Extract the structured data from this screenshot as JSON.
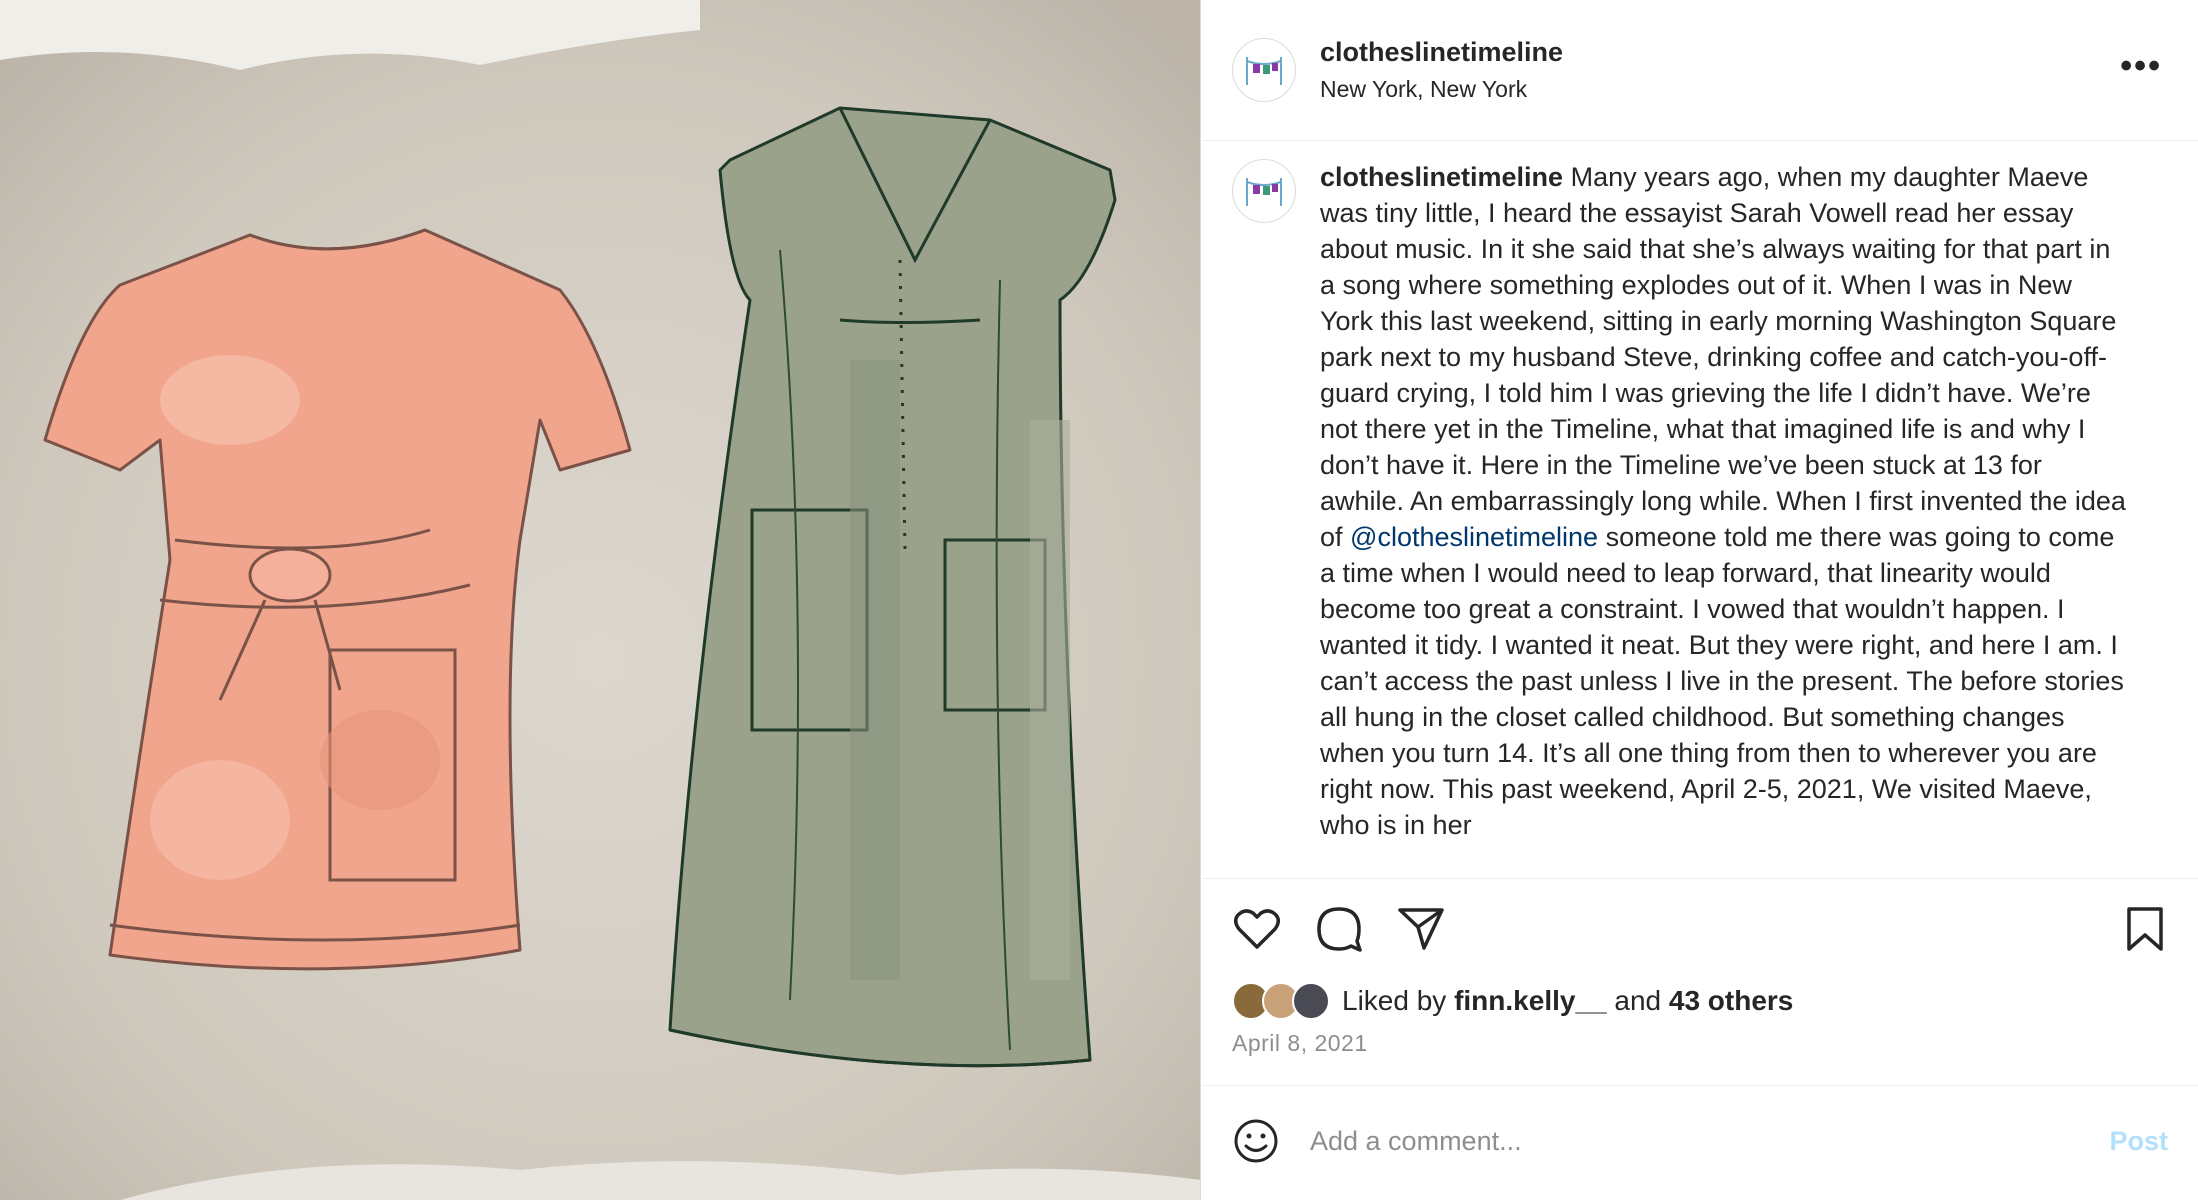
{
  "colors": {
    "mention": "#00376b",
    "post_button_disabled": "#b2dffc",
    "meta_gray": "#8e8e8e",
    "canvas_bg": "#d4cec4",
    "pink_dress": "#f0a58c",
    "green_dress": "#9aa28c"
  },
  "image": {
    "subject": "watercolor sketch of two dresses"
  },
  "header": {
    "username": "clotheslinetimeline",
    "location": "New York, New York",
    "more_icon": "more-horizontal-icon"
  },
  "caption": {
    "username": "clotheslinetimeline",
    "text_before_mention": "Many years ago, when my daughter Maeve was tiny little, I heard the essayist Sarah Vowell read her essay about music. In it she said that she’s always waiting for that part in a song where something explodes out of it. When I was in New York this last weekend, sitting in early morning Washington Square park next to my husband Steve, drinking coffee and catch-you-off-guard crying, I told him I was grieving the life I didn’t have. We’re not there yet in the Timeline, what that imagined life is and why I don’t have it. Here in the Timeline we’ve been stuck at 13 for awhile. An embarrassingly long while. When I first invented the idea of",
    "mention": "@clotheslinetimeline",
    "text_after_mention": "someone told me there was going to come a time when I would need to leap forward, that linearity would become too great a constraint. I vowed that wouldn’t happen. I wanted it tidy. I wanted it neat. But they were right, and here I am. I can’t access the past unless I live in the present. The before stories all hung in the closet called childhood. But something changes when you turn 14. It’s all one thing from then to wherever you are right now. This past weekend, April 2-5, 2021,  We visited Maeve, who is in her"
  },
  "actions": {
    "like_icon": "heart-icon",
    "comment_icon": "comment-icon",
    "share_icon": "send-icon",
    "save_icon": "bookmark-icon"
  },
  "likes": {
    "prefix": "Liked by",
    "user": "finn.kelly__",
    "middle": "and",
    "others": "43 others"
  },
  "date": "April 8, 2021",
  "comment": {
    "placeholder": "Add a comment...",
    "post_label": "Post",
    "emoji_icon": "smiley-icon"
  }
}
